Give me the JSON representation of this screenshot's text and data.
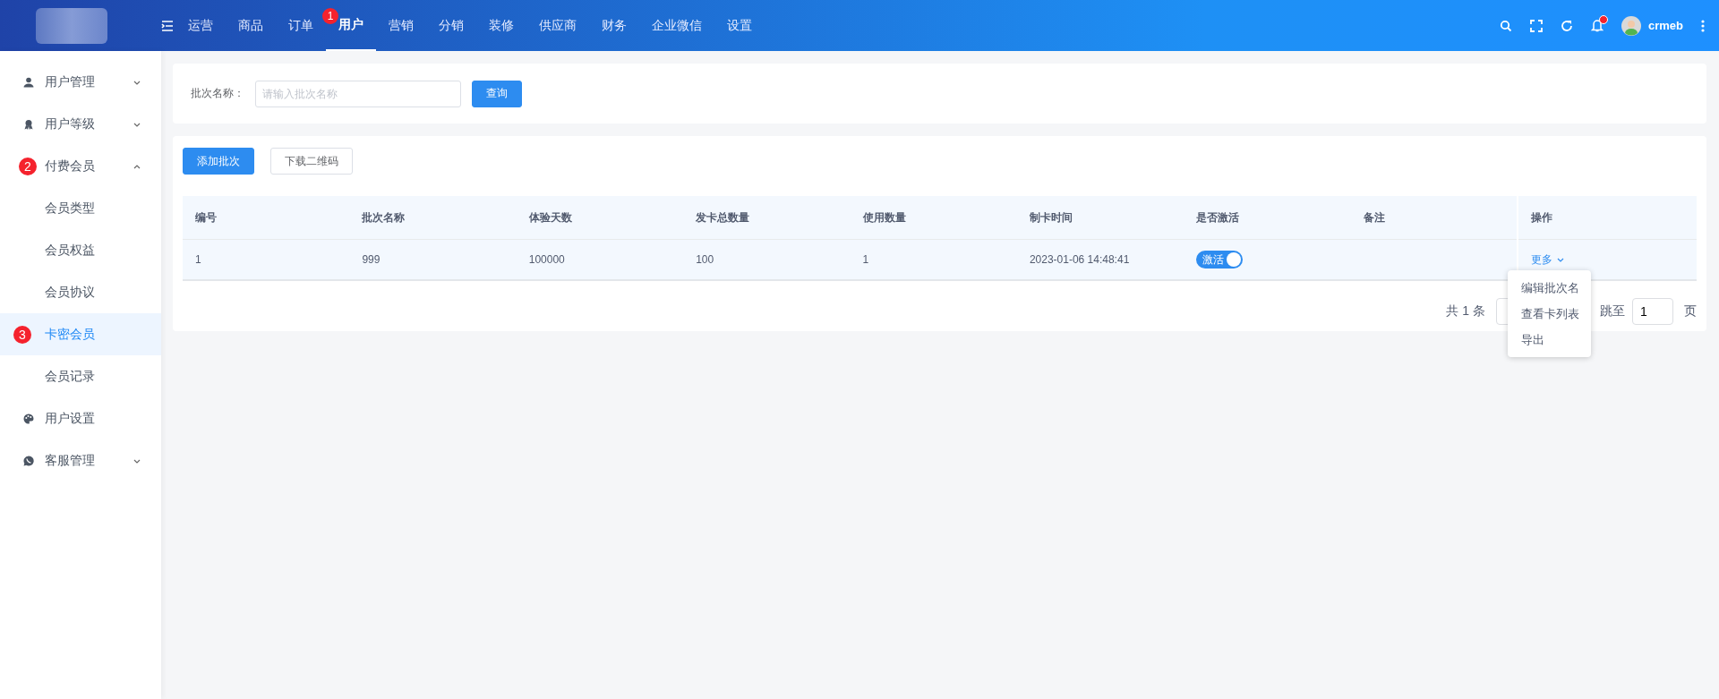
{
  "header": {
    "nav": [
      {
        "label": "运营",
        "selected": false
      },
      {
        "label": "商品",
        "selected": false
      },
      {
        "label": "订单",
        "selected": false
      },
      {
        "label": "用户",
        "selected": true,
        "badge": "1"
      },
      {
        "label": "营销",
        "selected": false
      },
      {
        "label": "分销",
        "selected": false
      },
      {
        "label": "装修",
        "selected": false
      },
      {
        "label": "供应商",
        "selected": false
      },
      {
        "label": "财务",
        "selected": false
      },
      {
        "label": "企业微信",
        "selected": false
      },
      {
        "label": "设置",
        "selected": false
      }
    ],
    "notifications_unread": true,
    "user": "crmeb"
  },
  "sidebar": {
    "items": [
      {
        "label": "用户管理",
        "expanded": false,
        "selected": false,
        "kind": "group"
      },
      {
        "label": "用户等级",
        "expanded": false,
        "selected": false,
        "kind": "group"
      },
      {
        "label": "付费会员",
        "expanded": true,
        "selected": false,
        "kind": "group",
        "badge": "2",
        "children": [
          {
            "label": "会员类型",
            "selected": false
          },
          {
            "label": "会员权益",
            "selected": false
          },
          {
            "label": "会员协议",
            "selected": false
          },
          {
            "label": "卡密会员",
            "selected": true,
            "badge": "3"
          },
          {
            "label": "会员记录",
            "selected": false
          }
        ]
      },
      {
        "label": "用户设置",
        "selected": false,
        "kind": "link"
      },
      {
        "label": "客服管理",
        "expanded": false,
        "selected": false,
        "kind": "group"
      }
    ]
  },
  "search": {
    "label": "批次名称：",
    "placeholder": "请输入批次名称",
    "button": "查询"
  },
  "toolbar": [
    {
      "label": "添加批次",
      "kind": "primary"
    },
    {
      "label": "下载二维码",
      "kind": "default"
    }
  ],
  "table": {
    "columns": [
      "编号",
      "批次名称",
      "体验天数",
      "发卡总数量",
      "使用数量",
      "制卡时间",
      "是否激活",
      "备注",
      "操作"
    ],
    "rows": [
      {
        "cells": [
          "1",
          "999",
          "100000",
          "100",
          "1",
          "2023-01-06 14:48:41"
        ],
        "active": {
          "on": true,
          "label": "激活"
        },
        "action": "更多"
      }
    ]
  },
  "dropdown": [
    "编辑批次名",
    "查看卡列表",
    "导出"
  ],
  "pagination": {
    "total": "共 1 条",
    "jump": "跳至",
    "page": "1",
    "suffix": "页"
  }
}
